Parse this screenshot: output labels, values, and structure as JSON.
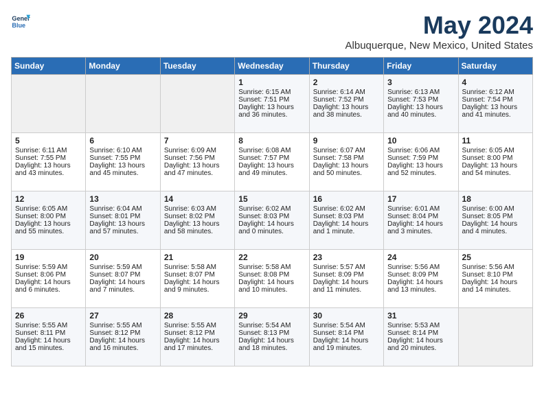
{
  "header": {
    "logo_line1": "General",
    "logo_line2": "Blue",
    "month": "May 2024",
    "location": "Albuquerque, New Mexico, United States"
  },
  "days_of_week": [
    "Sunday",
    "Monday",
    "Tuesday",
    "Wednesday",
    "Thursday",
    "Friday",
    "Saturday"
  ],
  "weeks": [
    [
      {
        "day": "",
        "content": ""
      },
      {
        "day": "",
        "content": ""
      },
      {
        "day": "",
        "content": ""
      },
      {
        "day": "1",
        "content": "Sunrise: 6:15 AM\nSunset: 7:51 PM\nDaylight: 13 hours\nand 36 minutes."
      },
      {
        "day": "2",
        "content": "Sunrise: 6:14 AM\nSunset: 7:52 PM\nDaylight: 13 hours\nand 38 minutes."
      },
      {
        "day": "3",
        "content": "Sunrise: 6:13 AM\nSunset: 7:53 PM\nDaylight: 13 hours\nand 40 minutes."
      },
      {
        "day": "4",
        "content": "Sunrise: 6:12 AM\nSunset: 7:54 PM\nDaylight: 13 hours\nand 41 minutes."
      }
    ],
    [
      {
        "day": "5",
        "content": "Sunrise: 6:11 AM\nSunset: 7:55 PM\nDaylight: 13 hours\nand 43 minutes."
      },
      {
        "day": "6",
        "content": "Sunrise: 6:10 AM\nSunset: 7:55 PM\nDaylight: 13 hours\nand 45 minutes."
      },
      {
        "day": "7",
        "content": "Sunrise: 6:09 AM\nSunset: 7:56 PM\nDaylight: 13 hours\nand 47 minutes."
      },
      {
        "day": "8",
        "content": "Sunrise: 6:08 AM\nSunset: 7:57 PM\nDaylight: 13 hours\nand 49 minutes."
      },
      {
        "day": "9",
        "content": "Sunrise: 6:07 AM\nSunset: 7:58 PM\nDaylight: 13 hours\nand 50 minutes."
      },
      {
        "day": "10",
        "content": "Sunrise: 6:06 AM\nSunset: 7:59 PM\nDaylight: 13 hours\nand 52 minutes."
      },
      {
        "day": "11",
        "content": "Sunrise: 6:05 AM\nSunset: 8:00 PM\nDaylight: 13 hours\nand 54 minutes."
      }
    ],
    [
      {
        "day": "12",
        "content": "Sunrise: 6:05 AM\nSunset: 8:00 PM\nDaylight: 13 hours\nand 55 minutes."
      },
      {
        "day": "13",
        "content": "Sunrise: 6:04 AM\nSunset: 8:01 PM\nDaylight: 13 hours\nand 57 minutes."
      },
      {
        "day": "14",
        "content": "Sunrise: 6:03 AM\nSunset: 8:02 PM\nDaylight: 13 hours\nand 58 minutes."
      },
      {
        "day": "15",
        "content": "Sunrise: 6:02 AM\nSunset: 8:03 PM\nDaylight: 14 hours\nand 0 minutes."
      },
      {
        "day": "16",
        "content": "Sunrise: 6:02 AM\nSunset: 8:03 PM\nDaylight: 14 hours\nand 1 minute."
      },
      {
        "day": "17",
        "content": "Sunrise: 6:01 AM\nSunset: 8:04 PM\nDaylight: 14 hours\nand 3 minutes."
      },
      {
        "day": "18",
        "content": "Sunrise: 6:00 AM\nSunset: 8:05 PM\nDaylight: 14 hours\nand 4 minutes."
      }
    ],
    [
      {
        "day": "19",
        "content": "Sunrise: 5:59 AM\nSunset: 8:06 PM\nDaylight: 14 hours\nand 6 minutes."
      },
      {
        "day": "20",
        "content": "Sunrise: 5:59 AM\nSunset: 8:07 PM\nDaylight: 14 hours\nand 7 minutes."
      },
      {
        "day": "21",
        "content": "Sunrise: 5:58 AM\nSunset: 8:07 PM\nDaylight: 14 hours\nand 9 minutes."
      },
      {
        "day": "22",
        "content": "Sunrise: 5:58 AM\nSunset: 8:08 PM\nDaylight: 14 hours\nand 10 minutes."
      },
      {
        "day": "23",
        "content": "Sunrise: 5:57 AM\nSunset: 8:09 PM\nDaylight: 14 hours\nand 11 minutes."
      },
      {
        "day": "24",
        "content": "Sunrise: 5:56 AM\nSunset: 8:09 PM\nDaylight: 14 hours\nand 13 minutes."
      },
      {
        "day": "25",
        "content": "Sunrise: 5:56 AM\nSunset: 8:10 PM\nDaylight: 14 hours\nand 14 minutes."
      }
    ],
    [
      {
        "day": "26",
        "content": "Sunrise: 5:55 AM\nSunset: 8:11 PM\nDaylight: 14 hours\nand 15 minutes."
      },
      {
        "day": "27",
        "content": "Sunrise: 5:55 AM\nSunset: 8:12 PM\nDaylight: 14 hours\nand 16 minutes."
      },
      {
        "day": "28",
        "content": "Sunrise: 5:55 AM\nSunset: 8:12 PM\nDaylight: 14 hours\nand 17 minutes."
      },
      {
        "day": "29",
        "content": "Sunrise: 5:54 AM\nSunset: 8:13 PM\nDaylight: 14 hours\nand 18 minutes."
      },
      {
        "day": "30",
        "content": "Sunrise: 5:54 AM\nSunset: 8:14 PM\nDaylight: 14 hours\nand 19 minutes."
      },
      {
        "day": "31",
        "content": "Sunrise: 5:53 AM\nSunset: 8:14 PM\nDaylight: 14 hours\nand 20 minutes."
      },
      {
        "day": "",
        "content": ""
      }
    ]
  ]
}
